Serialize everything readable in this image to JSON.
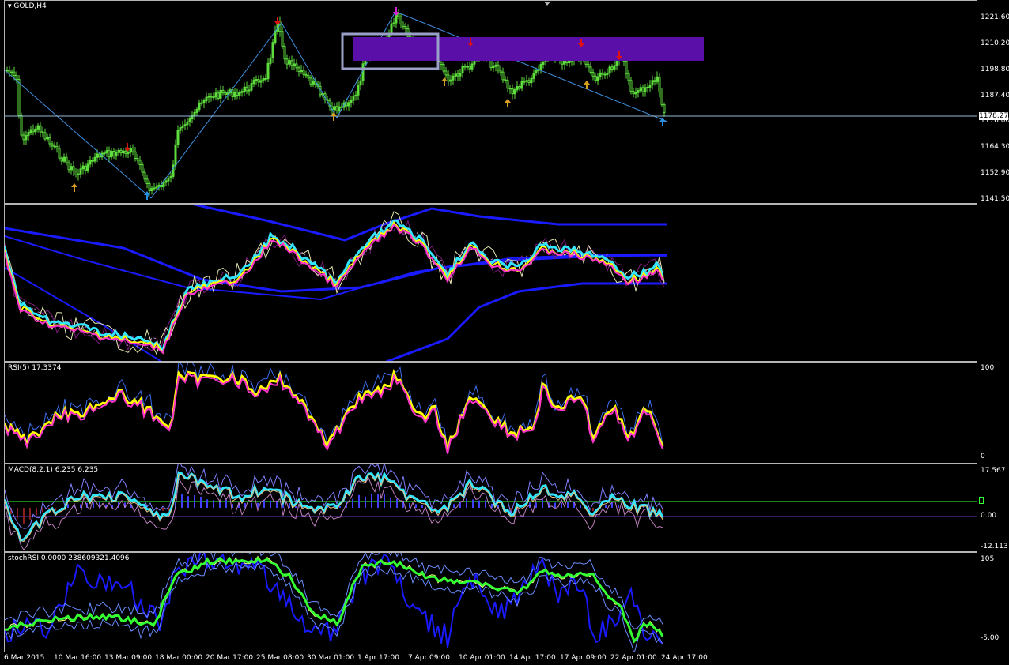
{
  "main": {
    "title": "GOLD,H4",
    "price_scale": [
      "1221.60",
      "1210.20",
      "1198.80",
      "1187.40",
      "1176.00",
      "1164.30",
      "1152.90",
      "1141.50"
    ],
    "current_price": "1178.27",
    "box_color": "#5a0fa8",
    "up_arrow_colors": [
      "#d8a020",
      "#2b8fe0"
    ],
    "down_arrow_colors": [
      "#e01010",
      "#d020d0"
    ]
  },
  "bands": {
    "label": ""
  },
  "rsi": {
    "label": "RSI(5) 17.3374",
    "scale": [
      "100",
      "0"
    ]
  },
  "macd": {
    "label": "MACD(8,2,1) 6.235 6.235",
    "scale": [
      "17.567",
      "0.00",
      "-12.113"
    ]
  },
  "stoch": {
    "label": "stochRSI 0.0000 238609321.4096",
    "scale": [
      "105",
      "-5.00"
    ]
  },
  "time_axis": [
    "6 Mar 2015",
    "10 Mar 16:00",
    "13 Mar 09:00",
    "18 Mar 00:00",
    "20 Mar 17:00",
    "25 Mar 08:00",
    "30 Mar 01:00",
    "1 Apr 17:00",
    "7 Apr 09:00",
    "10 Apr 01:00",
    "14 Apr 17:00",
    "17 Apr 09:00",
    "22 Apr 01:00",
    "24 Apr 17:00"
  ],
  "colors": {
    "candle": "#5ddc3c",
    "trend": "#3d8ee0",
    "blue": "#1a1aff",
    "cyan": "#33e6ff",
    "yellow": "#ffff00",
    "magenta": "#ff33cc",
    "purple": "#7a1a7a",
    "green": "#33ff33"
  }
}
